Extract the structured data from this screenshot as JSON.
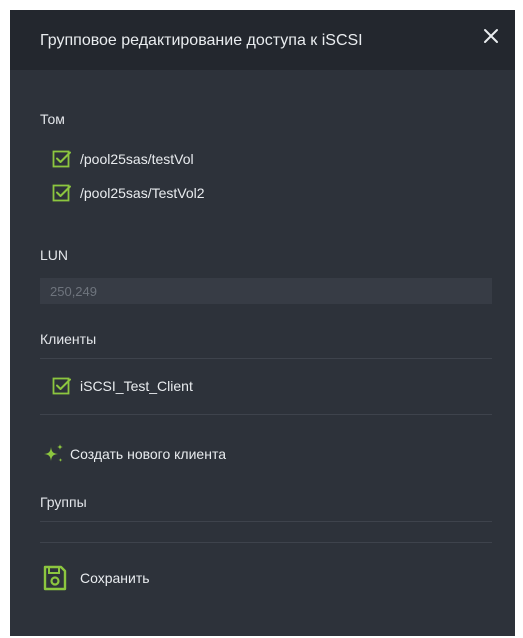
{
  "dialog": {
    "title": "Групповое редактирование доступа к iSCSI",
    "close_icon": "close-icon"
  },
  "volume": {
    "label": "Том",
    "items": [
      {
        "label": "/pool25sas/testVol",
        "checked": true
      },
      {
        "label": "/pool25sas/TestVol2",
        "checked": true
      }
    ]
  },
  "lun": {
    "label": "LUN",
    "placeholder": "250,249",
    "value": ""
  },
  "clients": {
    "label": "Клиенты",
    "items": [
      {
        "label": "iSCSI_Test_Client",
        "checked": true
      }
    ],
    "create_label": "Создать нового клиента",
    "create_icon": "sparkle-icon"
  },
  "groups": {
    "label": "Группы"
  },
  "actions": {
    "save_label": "Сохранить",
    "save_icon": "save-icon"
  },
  "colors": {
    "accent": "#8cc63f",
    "panel": "#2d323a",
    "header": "#23272e"
  }
}
